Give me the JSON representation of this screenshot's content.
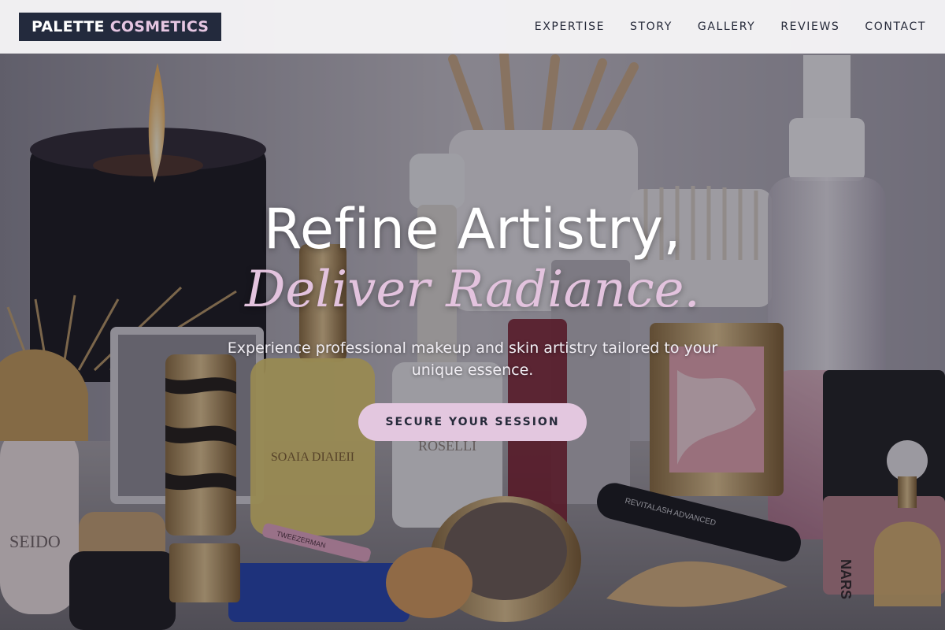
{
  "header": {
    "logo_word1": "PALETTE",
    "logo_word2": "COSMETICS",
    "nav": [
      {
        "label": "EXPERTISE"
      },
      {
        "label": "STORY"
      },
      {
        "label": "GALLERY"
      },
      {
        "label": "REVIEWS"
      },
      {
        "label": "CONTACT"
      }
    ]
  },
  "hero": {
    "title_line1": "Refine Artistry,",
    "title_line2": "Deliver Radiance.",
    "subtitle": "Experience professional makeup and skin artistry tailored to your unique essence.",
    "cta_label": "SECURE YOUR SESSION",
    "background_image": {
      "product_labels": [
        "TWEEZERMAN",
        "REVITALASH ADVANCED",
        "ROSELLI",
        "NARS",
        "SEIDO"
      ]
    }
  },
  "colors": {
    "accent": "#e3c7df",
    "navy": "#232a3d",
    "header_bg": "#f6f5f7",
    "title_white": "#ffffff",
    "title_pink": "#e3c3de"
  }
}
